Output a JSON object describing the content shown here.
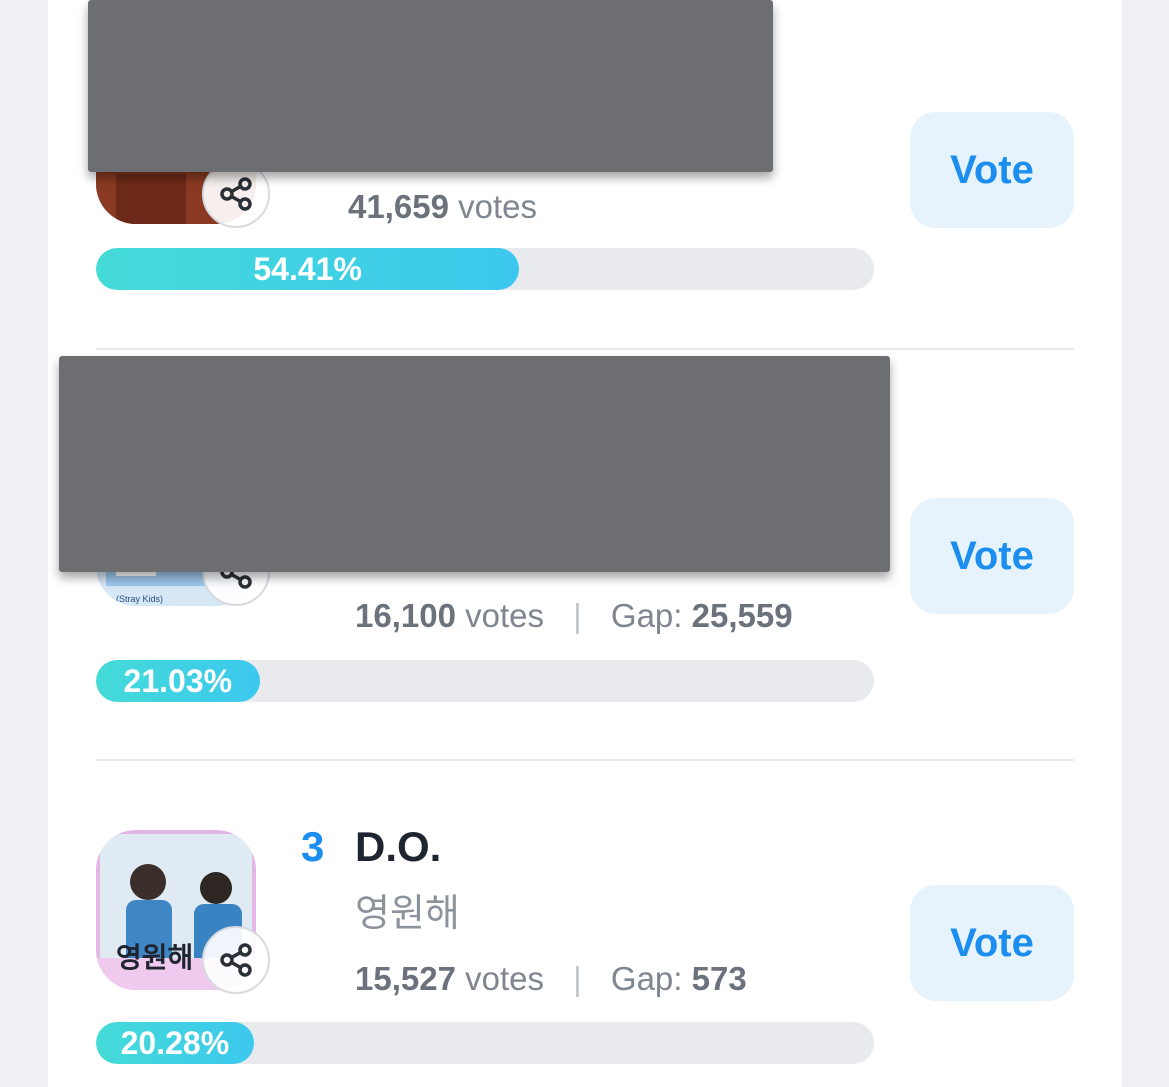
{
  "entries": [
    {
      "rank": "",
      "artist": "",
      "song": "",
      "votes_number": "41,659",
      "votes_label": "votes",
      "gap_label": "",
      "gap_value": "",
      "percent_label": "54.41%",
      "percent": 54.41,
      "vote_label": "Vote",
      "thumb_icon": "album-cover-image"
    },
    {
      "rank": "",
      "artist": "",
      "song": "",
      "votes_number": "16,100",
      "votes_label": "votes",
      "gap_label": "Gap:",
      "gap_value": "25,559",
      "percent_label": "21.03%",
      "percent": 21.03,
      "vote_label": "Vote",
      "thumb_caption": "(Stray Kids)",
      "thumb_icon": "album-cover-image"
    },
    {
      "rank": "3",
      "artist": "D.O.",
      "song": "영원해",
      "votes_number": "15,527",
      "votes_label": "votes",
      "gap_label": "Gap:",
      "gap_value": "573",
      "percent_label": "20.28%",
      "percent": 20.28,
      "vote_label": "Vote",
      "thumb_title": "영원해",
      "thumb_icon": "album-cover-image"
    }
  ],
  "icons": {
    "share": "share-icon"
  },
  "colors": {
    "accent": "#1b8ef0",
    "vote_button_bg": "#e6f3fd",
    "bar_fill_start": "#44dbd8",
    "bar_fill_end": "#3cc8ee",
    "bar_track": "#e8eaee",
    "redaction": "#6d6e72"
  }
}
